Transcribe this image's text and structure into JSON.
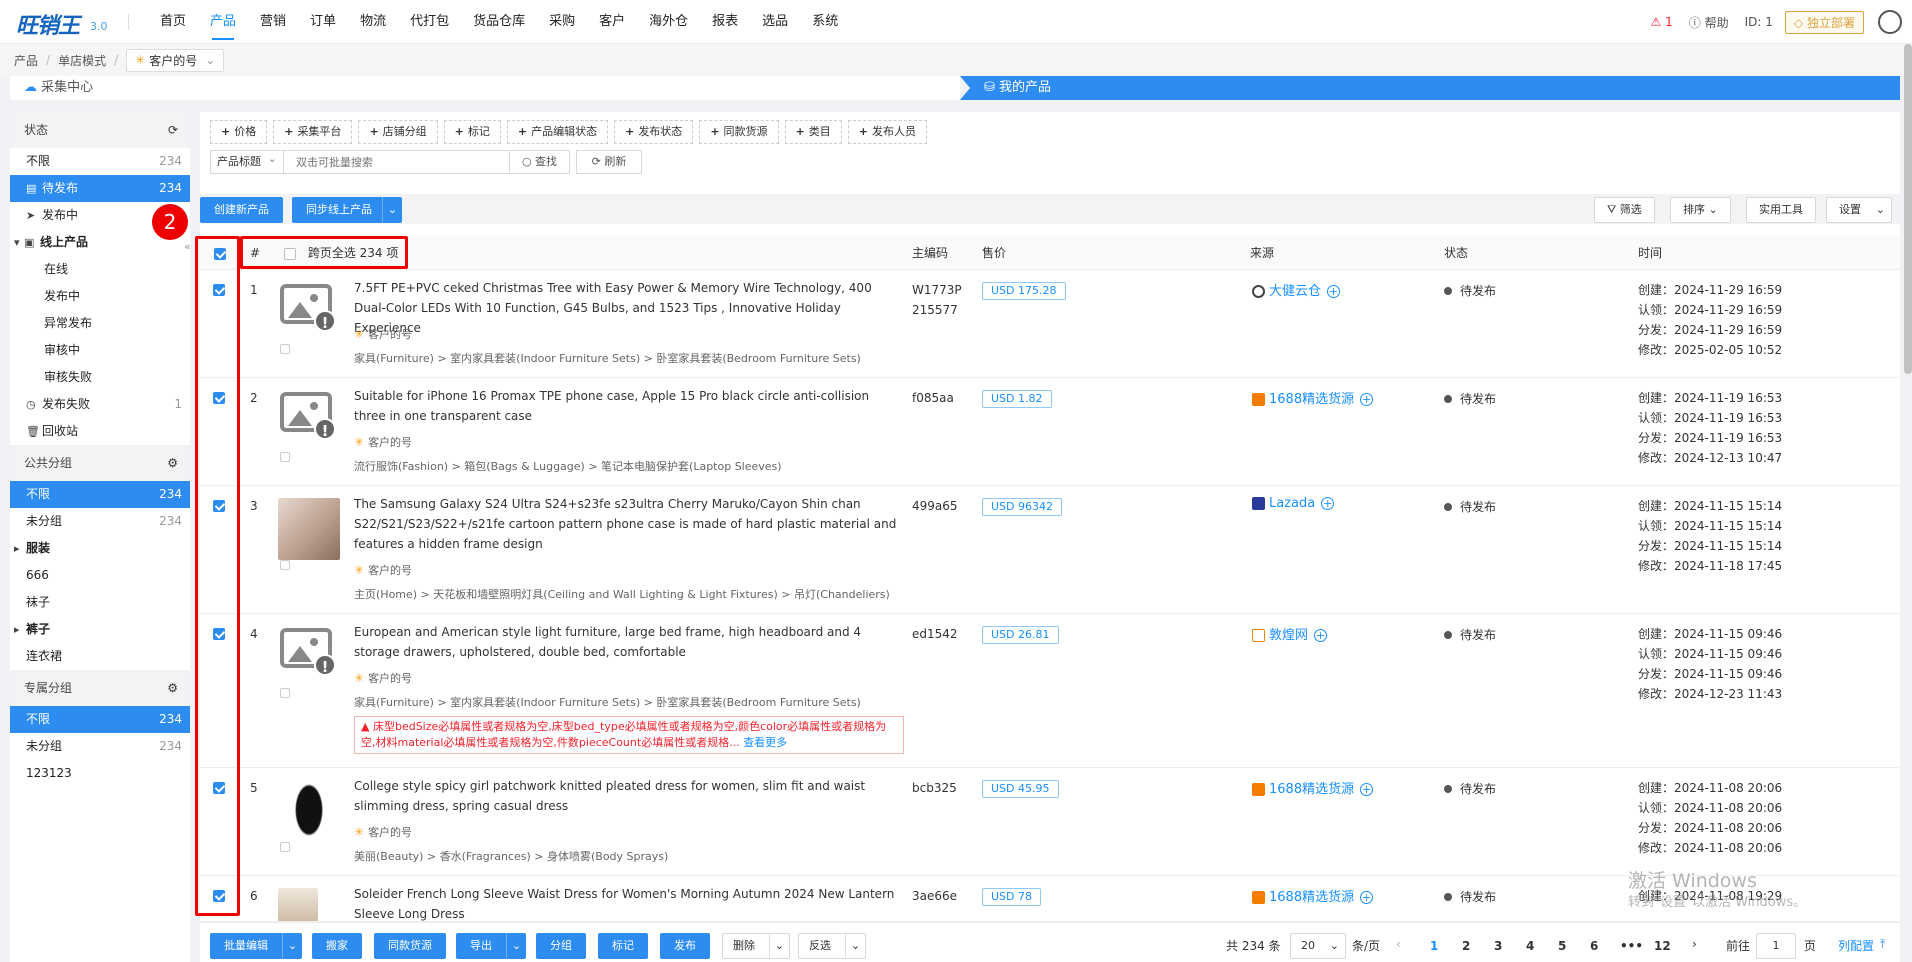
{
  "app": {
    "logo": "旺销王",
    "version": "3.0"
  },
  "nav": [
    "首页",
    "产品",
    "营销",
    "订单",
    "物流",
    "代打包",
    "货品仓库",
    "采购",
    "客户",
    "海外仓",
    "报表",
    "选品",
    "系统"
  ],
  "nav_active_index": 1,
  "top_right": {
    "warn": "1",
    "help": "帮助",
    "uid": "ID: 1",
    "deploy": "独立部署"
  },
  "breadcrumb": {
    "a": "产品",
    "b": "单店模式",
    "shop": "客户的号"
  },
  "tabs": {
    "collect": "采集中心",
    "mine": "我的产品"
  },
  "sidebar": {
    "status_title": "状态",
    "status_items": [
      {
        "label": "不限",
        "count": "234"
      },
      {
        "label": "待发布",
        "count": "234"
      },
      {
        "label": "发布中",
        "count": ""
      },
      {
        "label": "线上产品",
        "count": ""
      },
      {
        "label": "在线",
        "count": ""
      },
      {
        "label": "发布中",
        "count": ""
      },
      {
        "label": "异常发布",
        "count": ""
      },
      {
        "label": "审核中",
        "count": ""
      },
      {
        "label": "审核失败",
        "count": ""
      },
      {
        "label": "发布失败",
        "count": "1"
      },
      {
        "label": "回收站",
        "count": ""
      }
    ],
    "public_title": "公共分组",
    "public_items": [
      {
        "label": "不限",
        "count": "234"
      },
      {
        "label": "未分组",
        "count": "234"
      },
      {
        "label": "服装",
        "count": ""
      },
      {
        "label": "666",
        "count": ""
      },
      {
        "label": "袜子",
        "count": ""
      },
      {
        "label": "裤子",
        "count": ""
      },
      {
        "label": "连衣裙",
        "count": ""
      }
    ],
    "private_title": "专属分组",
    "private_items": [
      {
        "label": "不限",
        "count": "234"
      },
      {
        "label": "未分组",
        "count": "234"
      },
      {
        "label": "123123",
        "count": ""
      }
    ]
  },
  "filters": [
    "价格",
    "采集平台",
    "店铺分组",
    "标记",
    "产品编辑状态",
    "发布状态",
    "同款货源",
    "类目",
    "发布人员"
  ],
  "search": {
    "field": "产品标题",
    "placeholder": "双击可批量搜索",
    "search_btn": "查找",
    "refresh_btn": "刷新"
  },
  "toolbar": {
    "create": "创建新产品",
    "sync": "同步线上产品",
    "filter": "筛选",
    "sort": "排序",
    "tools": "实用工具",
    "settings": "设置"
  },
  "table_header": {
    "hash": "#",
    "select_all": "跨页全选 234 项",
    "code": "主编码",
    "price": "售价",
    "source": "来源",
    "status": "状态",
    "time": "时间"
  },
  "rows": [
    {
      "idx": "1",
      "title": "7.5FT PE+PVC ceked Christmas Tree with Easy Power & Memory Wire Technology, 400 Dual-Color LEDs With 10 Function, G45 Bulbs, and 1523 Tips , Innovative Holiday Experience",
      "shop": "客户的号",
      "category": "家具(Furniture) > 室内家具套装(Indoor Furniture Sets) > 卧室家具套装(Bedroom Furniture Sets)",
      "code": "W1773P215577",
      "price": "USD  175.28",
      "source": "大健云仓",
      "status": "待发布",
      "created": "创建：2024-11-29 16:59",
      "claimed": "认领：2024-11-29 16:59",
      "dist": "分发：2024-11-29 16:59",
      "modified": "修改：2025-02-05 10:52"
    },
    {
      "idx": "2",
      "title": "Suitable for iPhone 16 Promax TPE phone case, Apple 15 Pro black circle anti-collision three in one transparent case",
      "shop": "客户的号",
      "category": "流行服饰(Fashion) > 箱包(Bags & Luggage) > 笔记本电脑保护套(Laptop Sleeves)",
      "code": "f085aa",
      "price": "USD  1.82",
      "source": "1688精选货源",
      "status": "待发布",
      "created": "创建：2024-11-19 16:53",
      "claimed": "认领：2024-11-19 16:53",
      "dist": "分发：2024-11-19 16:53",
      "modified": "修改：2024-12-13 10:47"
    },
    {
      "idx": "3",
      "title": "The Samsung Galaxy S24 Ultra S24+s23fe s23ultra Cherry Maruko/Cayon Shin chan S22/S21/S23/S22+/s21fe cartoon pattern phone case is made of hard plastic material and features a hidden frame design",
      "shop": "客户的号",
      "category": "主页(Home) > 天花板和墙壁照明灯具(Ceiling and Wall Lighting & Light Fixtures) > 吊灯(Chandeliers)",
      "code": "499a65",
      "price": "USD  96342",
      "source": "Lazada",
      "status": "待发布",
      "created": "创建：2024-11-15 15:14",
      "claimed": "认领：2024-11-15 15:14",
      "dist": "分发：2024-11-15 15:14",
      "modified": "修改：2024-11-18 17:45"
    },
    {
      "idx": "4",
      "title": "European and American style light furniture, large bed frame, high headboard and 4 storage drawers, upholstered, double bed, comfortable",
      "shop": "客户的号",
      "category": "家具(Furniture) > 室内家具套装(Indoor Furniture Sets) > 卧室家具套装(Bedroom Furniture Sets)",
      "error": "床型bedSize必填属性或者规格为空,床型bed_type必填属性或者规格为空,颜色color必填属性或者规格为空,材料material必填属性或者规格为空,件数pieceCount必填属性或者规格...",
      "error_more": "查看更多",
      "code": "ed1542",
      "price": "USD  26.81",
      "source": "敦煌网",
      "status": "待发布",
      "created": "创建：2024-11-15 09:46",
      "claimed": "认领：2024-11-15 09:46",
      "dist": "分发：2024-11-15 09:46",
      "modified": "修改：2024-12-23 11:43"
    },
    {
      "idx": "5",
      "title": "College style spicy girl patchwork knitted pleated dress for women, slim fit and waist slimming dress, spring casual dress",
      "shop": "客户的号",
      "category": "美丽(Beauty) > 香水(Fragrances) > 身体喷雾(Body Sprays)",
      "code": "bcb325",
      "price": "USD  45.95",
      "source": "1688精选货源",
      "status": "待发布",
      "created": "创建：2024-11-08 20:06",
      "claimed": "认领：2024-11-08 20:06",
      "dist": "分发：2024-11-08 20:06",
      "modified": "修改：2024-11-08 20:06"
    },
    {
      "idx": "6",
      "title": "Soleider French Long Sleeve Waist Dress for Women's Morning Autumn 2024 New Lantern Sleeve Long Dress",
      "code": "3ae66e",
      "price": "USD  78",
      "source": "1688精选货源",
      "status": "待发布",
      "created": "创建：2024-11-08 19:29"
    }
  ],
  "footer": {
    "batch_edit": "批量编辑",
    "move": "搬家",
    "same_source": "同款货源",
    "export": "导出",
    "group": "分组",
    "mark": "标记",
    "publish": "发布",
    "delete": "删除",
    "invert": "反选",
    "total": "共 234 条",
    "page_size": "20",
    "per_page": "条/页",
    "pages": [
      "1",
      "2",
      "3",
      "4",
      "5",
      "6",
      "•••",
      "12"
    ],
    "goto": "前往",
    "goto_val": "1",
    "page_unit": "页",
    "col_config": "列配置"
  },
  "annotation": {
    "badge": "2"
  },
  "watermark": {
    "l1": "激活 Windows",
    "l2": "转到\"设置\"以激活 Windows。"
  }
}
